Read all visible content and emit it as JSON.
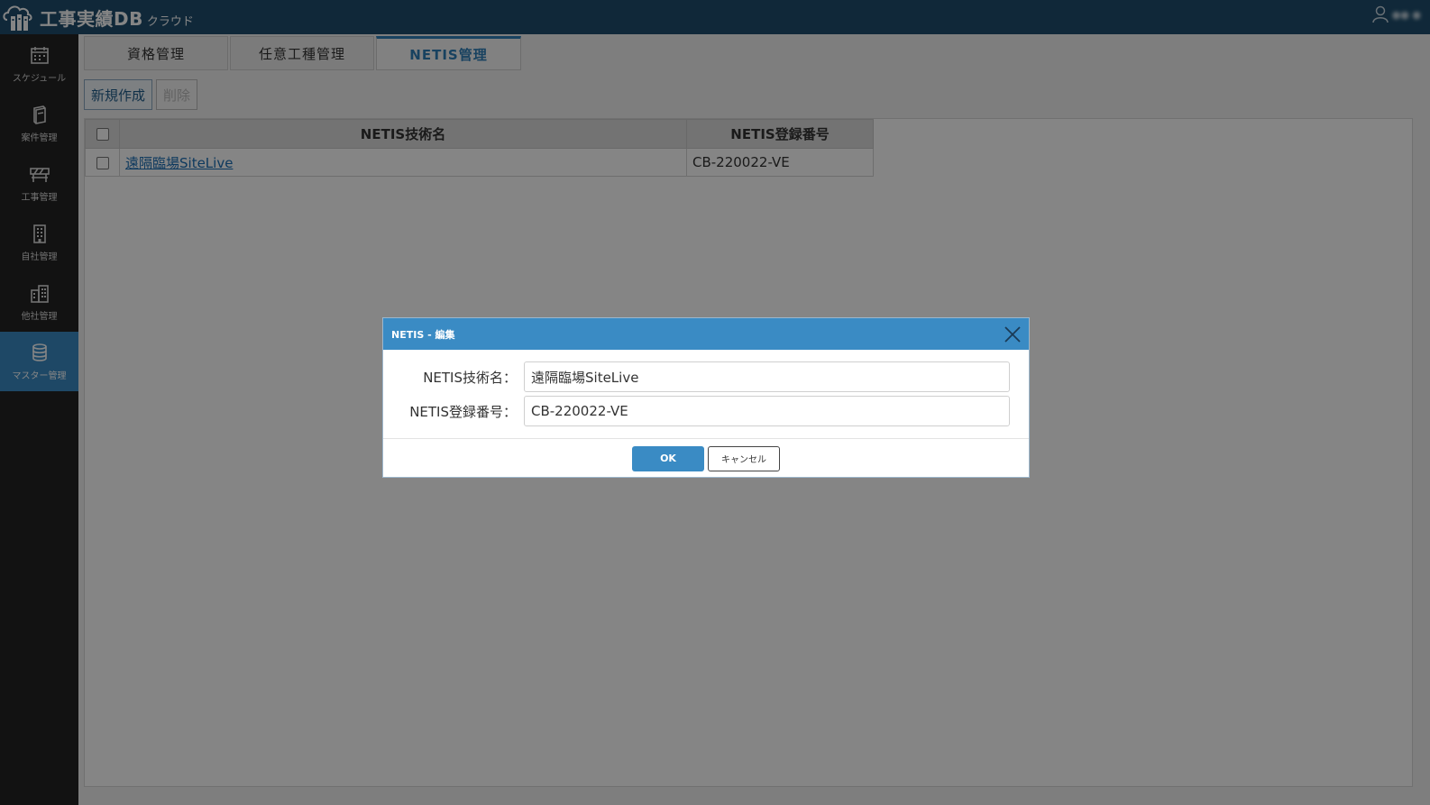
{
  "header": {
    "app_title": "工事実績DB",
    "app_subtitle": "クラウド",
    "user_name": "●● ●"
  },
  "sidebar": {
    "items": [
      {
        "label": "スケジュール",
        "icon": "calendar-icon"
      },
      {
        "label": "案件管理",
        "icon": "book-icon"
      },
      {
        "label": "工事管理",
        "icon": "barrier-icon"
      },
      {
        "label": "自社管理",
        "icon": "building-icon"
      },
      {
        "label": "他社管理",
        "icon": "buildings-icon"
      },
      {
        "label": "マスター管理",
        "icon": "database-icon",
        "active": true
      }
    ]
  },
  "tabs": [
    {
      "label": "資格管理"
    },
    {
      "label": "任意工種管理"
    },
    {
      "label": "NETIS管理",
      "active": true
    }
  ],
  "toolbar": {
    "new_label": "新規作成",
    "delete_label": "削除"
  },
  "grid": {
    "columns": [
      "NETIS技術名",
      "NETIS登録番号"
    ],
    "rows": [
      {
        "name": "遠隔臨場SiteLive",
        "number": "CB-220022-VE"
      }
    ]
  },
  "dialog": {
    "title": "NETIS - 編集",
    "name_label": "NETIS技術名：",
    "name_value": "遠隔臨場SiteLive",
    "number_label": "NETIS登録番号：",
    "number_value": "CB-220022-VE",
    "ok_label": "OK",
    "cancel_label": "キャンセル"
  },
  "colors": {
    "header_bg": "#1f4e6e",
    "accent": "#3a8bc4",
    "sidebar_bg": "#232323"
  }
}
